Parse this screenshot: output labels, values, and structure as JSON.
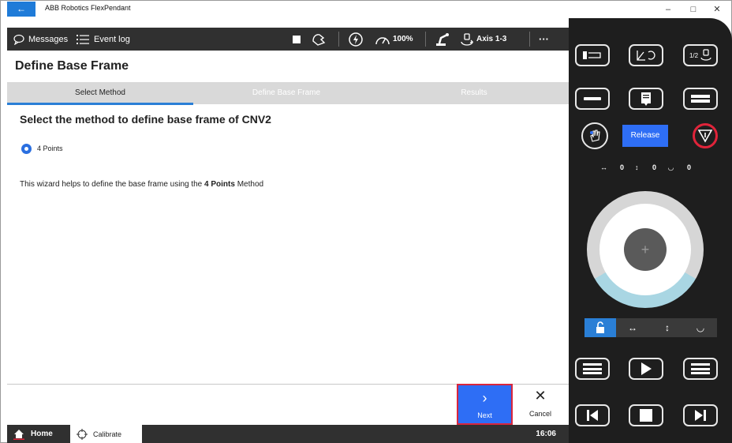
{
  "window": {
    "title": "ABB Robotics FlexPendant",
    "back_glyph": "←",
    "minimize_glyph": "–",
    "maximize_glyph": "□",
    "close_glyph": "✕"
  },
  "toolbar": {
    "messages_label": "Messages",
    "event_log_label": "Event log",
    "speed_label": "100%",
    "axis_label": "Axis 1-3",
    "more_glyph": "···"
  },
  "page": {
    "title": "Define Base Frame",
    "tabs": [
      {
        "label": "Select Method",
        "active": true
      },
      {
        "label": "Define Base Frame",
        "active": false
      },
      {
        "label": "Results",
        "active": false
      }
    ],
    "section_title": "Select the method to define base frame of CNV2",
    "radio_option": "4 Points",
    "description_prefix": "This wizard helps to define the base frame using the ",
    "description_bold": "4 Points",
    "description_suffix": " Method"
  },
  "actions": {
    "next_label": "Next",
    "next_glyph": "›",
    "cancel_label": "Cancel",
    "cancel_glyph": "✕"
  },
  "statusbar": {
    "home_label": "Home",
    "calibrate_label": "Calibrate",
    "clock": "16:06"
  },
  "pendant": {
    "release_label": "Release",
    "readout_h_glyph": "↔",
    "readout_h_value": "0",
    "readout_v_glyph": "↕",
    "readout_v_value": "0",
    "readout_r_glyph": "◡",
    "readout_r_value": "0",
    "joystick_glyph": "+",
    "mode_h_glyph": "↔",
    "mode_v_glyph": "↕",
    "mode_r_glyph": "◡",
    "ratio_label": "1/2"
  },
  "colors": {
    "accent_blue": "#2e6ef5",
    "tab_underline": "#2a7fd6",
    "highlight_border": "#d9263c",
    "dark_bar": "#303030",
    "pendant_bg": "#1e1e1e"
  }
}
